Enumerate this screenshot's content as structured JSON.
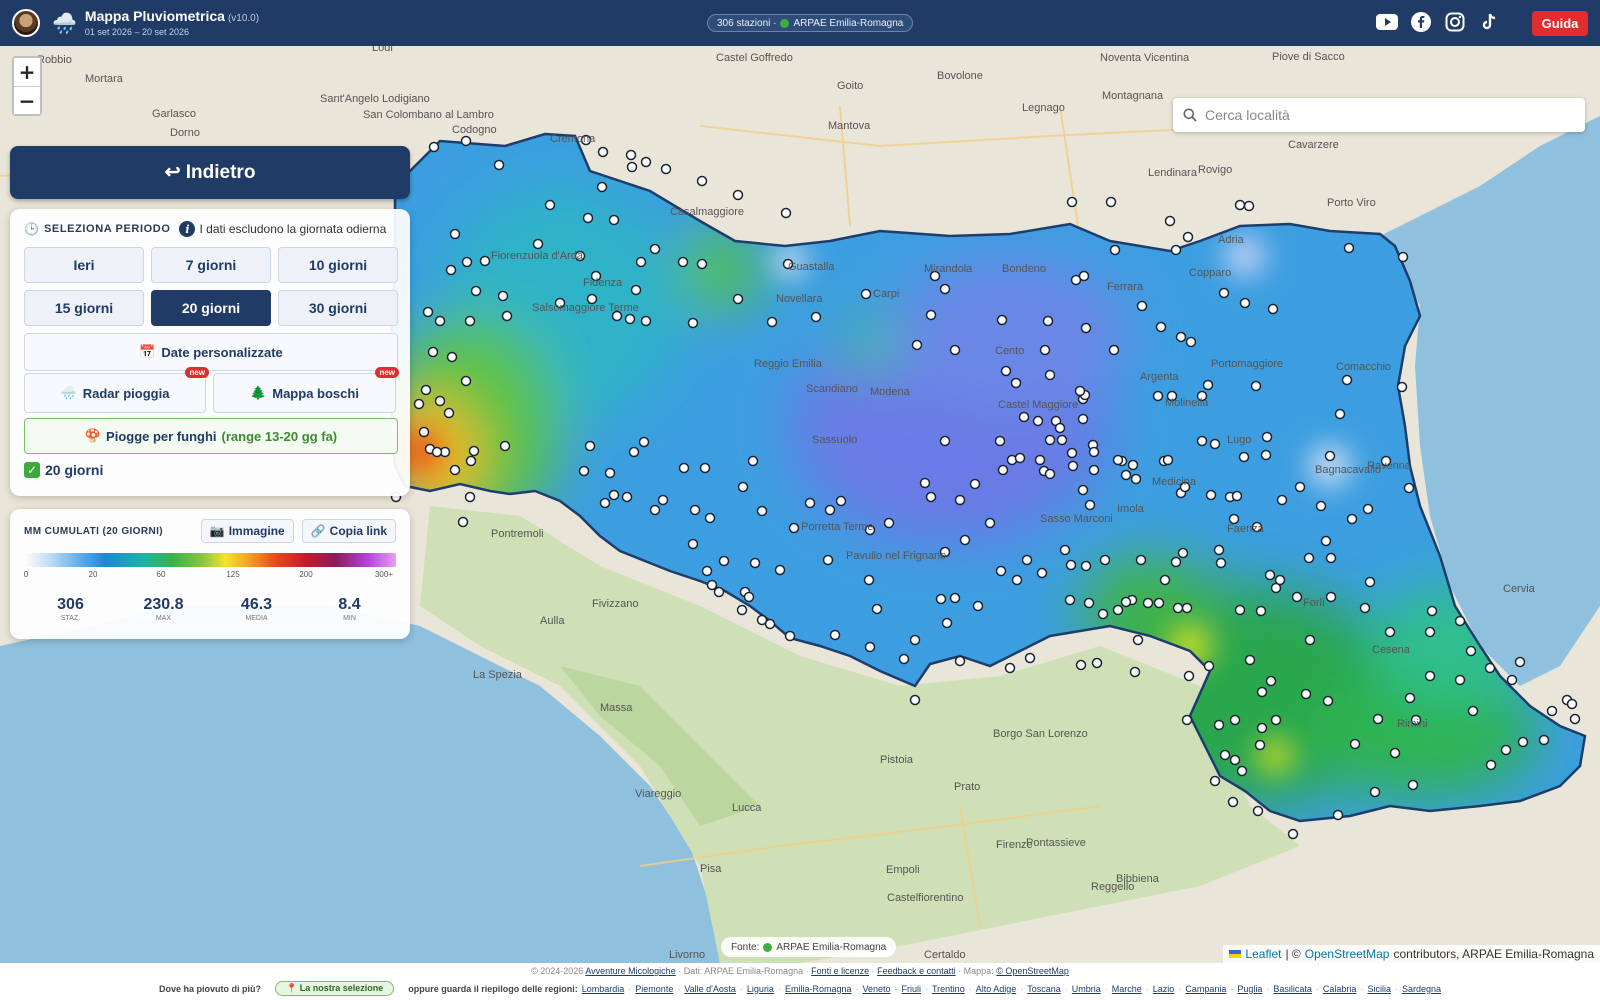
{
  "header": {
    "title": "Mappa Pluviometrica",
    "version": "(v10.0)",
    "date_range": "01 set 2026 – 20 set 2026",
    "station_pill": "306 stazioni · ",
    "source_region": "ARPAE Emilia-Romagna",
    "guida_label": "Guida",
    "weather_icon": "rain-cloud-icon"
  },
  "social": [
    "youtube-icon",
    "facebook-icon",
    "instagram-icon",
    "tiktok-icon"
  ],
  "search": {
    "placeholder": "Cerca località"
  },
  "back_label": "↩ Indietro",
  "period": {
    "label": "SELEZIONA PERIODO",
    "note": "I dati escludono la giornata odierna",
    "options": [
      "Ieri",
      "7 giorni",
      "10 giorni",
      "15 giorni",
      "20 giorni",
      "30 giorni"
    ],
    "active_index": 4,
    "custom_label": "Date personalizzate",
    "radar_label": "Radar pioggia",
    "boschi_label": "Mappa boschi",
    "new_badge": "new",
    "fungi_label": "Piogge per funghi",
    "fungi_range": "(range 13-20 gg fa)",
    "selected": "20 giorni"
  },
  "legend": {
    "title": "MM CUMULATI (20 GIORNI)",
    "image_label": "Immagine",
    "link_label": "Copia link",
    "ticks": [
      "0",
      "20",
      "60",
      "125",
      "200",
      "300+"
    ],
    "stats": [
      {
        "value": "306",
        "label": "STAZ."
      },
      {
        "value": "230.8",
        "label": "MAX"
      },
      {
        "value": "46.3",
        "label": "MEDIA"
      },
      {
        "value": "8.4",
        "label": "MIN"
      }
    ]
  },
  "map": {
    "fonte": "Fonte:",
    "fonte_source": "ARPAE Emilia-Romagna",
    "attrib_leaflet": "Leaflet",
    "attrib_sep": "| ©",
    "attrib_osm": "OpenStreetMap",
    "attrib_rest": "contributors, ARPAE Emilia-Romagna",
    "labels": [
      "Lodi",
      "Robbio",
      "Mortara",
      "Castel Goffredo",
      "Bovolone",
      "Noventa Vicentina",
      "Piove di Sacco",
      "Mantova",
      "Legnago",
      "Rovigo",
      "Cremona",
      "Casalmaggiore",
      "Ferrara",
      "Bondeno",
      "Mirandola",
      "Carpi",
      "Reggio Emilia",
      "Modena",
      "Cento",
      "Castel Maggiore",
      "Molinella",
      "Portomaggiore",
      "Comacchio",
      "Medicina",
      "Imola",
      "Faenza",
      "Forlì",
      "Ravenna",
      "Cesena",
      "Rimini",
      "Cervia",
      "Pontremoli",
      "Fivizzano",
      "Aulla",
      "La Spezia",
      "Massa",
      "Viareggio",
      "Lucca",
      "Pistoia",
      "Prato",
      "Firenze",
      "Empoli",
      "Pisa",
      "Livorno",
      "Castelfiorentino",
      "Pontassieve",
      "Bibbiena",
      "Certaldo",
      "Reggello",
      "Borgo San Lorenzo",
      "Sasso Marconi",
      "Porretta Terme",
      "Pavullo nel Frignano",
      "Scandiano",
      "Sassuolo",
      "Fidenza",
      "Salsomaggiore Terme",
      "Fiorenzuola d'Arda",
      "Codogno",
      "Garlasco",
      "Dorno",
      "San Colombano al Lambro",
      "Sant'Angelo Lodigiano",
      "Novellara",
      "Guastalla",
      "Argenta",
      "Bagnacavallo",
      "Lugo",
      "Montagnana",
      "Adria",
      "Porto Viro",
      "Cavarzere",
      "Lendinara",
      "Copparo",
      "Goito"
    ]
  },
  "footer": {
    "line1_prefix": "© 2024-2026 ",
    "line1_link1": "Avventure Micologiche",
    "line1_mid": " · Dati: ARPAE Emilia-Romagna · ",
    "line1_link2": "Fonti e licenze",
    "line1_sep": " · ",
    "line1_link3": "Feedback e contatti",
    "line1_map": " · Mappa: ",
    "line1_link4": "© OpenStreetMap",
    "question": "Dove ha piovuto di più?",
    "selection_pill": "La nostra selezione",
    "or_text": "oppure guarda il riepilogo delle regioni:",
    "regions": [
      "Lombardia",
      "Piemonte",
      "Valle d'Aosta",
      "Liguria",
      "Emilia-Romagna",
      "Veneto",
      "Friuli",
      "Trentino",
      "Alto Adige",
      "Toscana",
      "Umbria",
      "Marche",
      "Lazio",
      "Campania",
      "Puglia",
      "Basilicata",
      "Calabria",
      "Sicilia",
      "Sardegna"
    ]
  },
  "colors": {
    "header": "#1f3b66",
    "accent_red": "#e12d2d",
    "green": "#3da93d"
  }
}
